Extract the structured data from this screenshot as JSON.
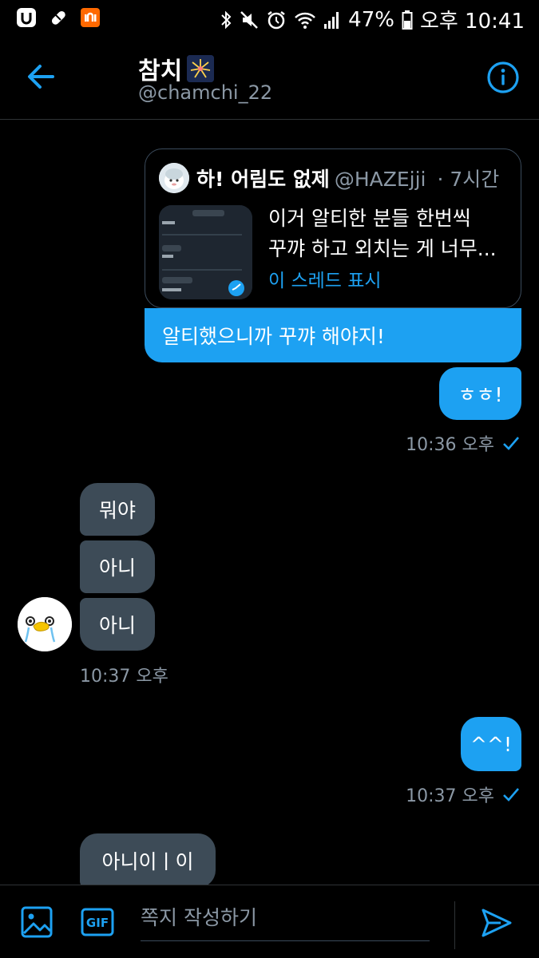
{
  "status_bar": {
    "battery": "47%",
    "time": "오후 10:41",
    "icons": [
      "u-app-icon",
      "pill-icon",
      "mi-app-icon",
      "bluetooth-icon",
      "mute-icon",
      "alarm-icon",
      "wifi-icon",
      "signal-icon",
      "battery-icon"
    ]
  },
  "header": {
    "name": "참치",
    "handle": "@chamchi_22",
    "back_icon": "back-arrow-icon",
    "info_icon": "info-icon"
  },
  "quote": {
    "author_name": "하! 어림도 없제",
    "author_handle": "@HAZEjji",
    "time": "· 7시간",
    "text_line1": "이거 알티한 분들 한번씩",
    "text_line2": "꾸꺄 하고 외치는 게 너무...",
    "thread_link": "이 스레드 표시"
  },
  "messages": {
    "m1": "알티했으니까 꾸꺄 해야지!",
    "m2": "ㅎㅎ!",
    "m2_time": "10:36 오후",
    "m3": "뭐야",
    "m4": "아니",
    "m5": "아니",
    "m5_time": "10:37 오후",
    "m6": "^^!",
    "m6_time": "10:37 오후",
    "m7": "아니이ㅣ이"
  },
  "composer": {
    "placeholder": "쪽지 작성하기",
    "gif_label": "GIF"
  },
  "colors": {
    "accent": "#1da1f2",
    "incoming_bubble": "#3d4b57",
    "muted_text": "#8b98a5",
    "background": "#000000"
  }
}
